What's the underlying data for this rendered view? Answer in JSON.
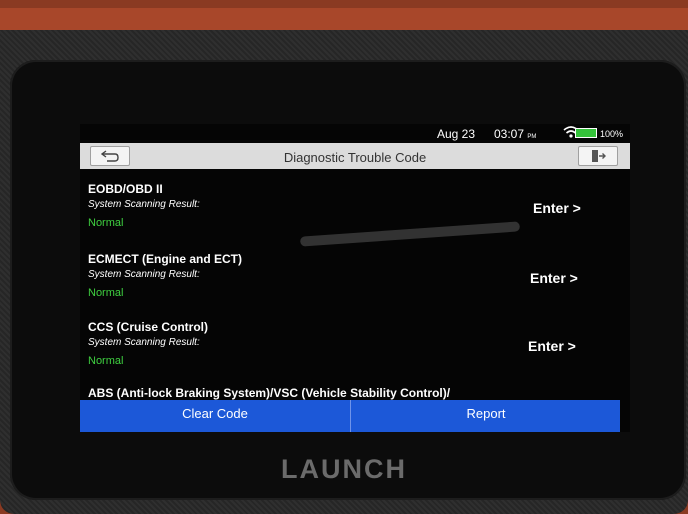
{
  "device": {
    "brand": "LAUNCH"
  },
  "status_bar": {
    "date": "Aug 23",
    "time": "03:07",
    "ampm": "PM",
    "battery": "100%",
    "battery_color": "#34c23a"
  },
  "header": {
    "title": "Diagnostic Trouble Code",
    "back_icon": "back-arrow-icon",
    "exit_icon": "exit-door-icon"
  },
  "systems": [
    {
      "name": "EOBD/OBD II",
      "label": "System Scanning Result:",
      "result": "Normal",
      "action": "Enter >"
    },
    {
      "name": "ECMECT (Engine and ECT)",
      "label": "System Scanning Result:",
      "result": "Normal",
      "action": "Enter >"
    },
    {
      "name": "CCS (Cruise Control)",
      "label": "System Scanning Result:",
      "result": "Normal",
      "action": "Enter >"
    },
    {
      "name": "ABS (Anti-lock Braking System)/VSC (Vehicle Stability Control)/"
    }
  ],
  "actions": {
    "clear_code": "Clear Code",
    "report": "Report",
    "color": "#1c58d8"
  },
  "colors": {
    "normal_result": "#3fd040",
    "title_bar": "#dcdcdc"
  }
}
